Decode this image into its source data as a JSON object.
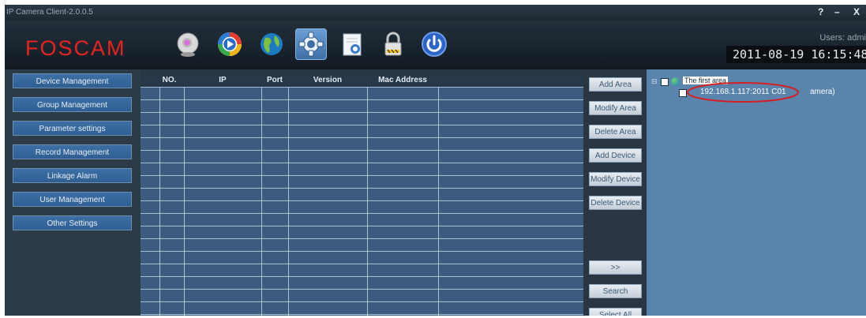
{
  "window": {
    "title": "IP Camera Client-2.0.0.5",
    "help": "?",
    "minimize": "–",
    "close": "X"
  },
  "header": {
    "logo": "FOSCAM",
    "users_label": "Users: admi",
    "datetime": "2011-08-19 16:15:48",
    "toolbar": [
      {
        "name": "live-video-icon",
        "active": false
      },
      {
        "name": "playback-icon",
        "active": false
      },
      {
        "name": "map-icon",
        "active": false
      },
      {
        "name": "settings-gear-icon",
        "active": true
      },
      {
        "name": "log-icon",
        "active": false
      },
      {
        "name": "lock-icon",
        "active": false
      },
      {
        "name": "power-icon",
        "active": false
      }
    ]
  },
  "sidebar": {
    "items": [
      {
        "label": "Device Management"
      },
      {
        "label": "Group Management"
      },
      {
        "label": "Parameter settings"
      },
      {
        "label": "Record Management"
      },
      {
        "label": "Linkage Alarm"
      },
      {
        "label": "User Management"
      },
      {
        "label": "Other Settings"
      }
    ]
  },
  "table": {
    "columns": [
      "NO.",
      "IP",
      "Port",
      "Version",
      "Mac Address"
    ],
    "rows": []
  },
  "actions": {
    "add_area": "Add Area",
    "modify_area": "Modify Area",
    "delete_area": "Delete Area",
    "add_device": "Add Device",
    "modify_device": "Modify Device",
    "delete_device": "Delete Device",
    "move": ">>",
    "search": "Search",
    "select_all": "Select All"
  },
  "tree": {
    "area_label": "The first area",
    "device_label": "192.168.1.117:2011 C01",
    "device_suffix": "amera)"
  },
  "colors": {
    "logo": "#e8231f",
    "active_tool": "#4f84bc",
    "tree_bg": "#5b84ad",
    "table_bg": "#3b5c7f"
  }
}
